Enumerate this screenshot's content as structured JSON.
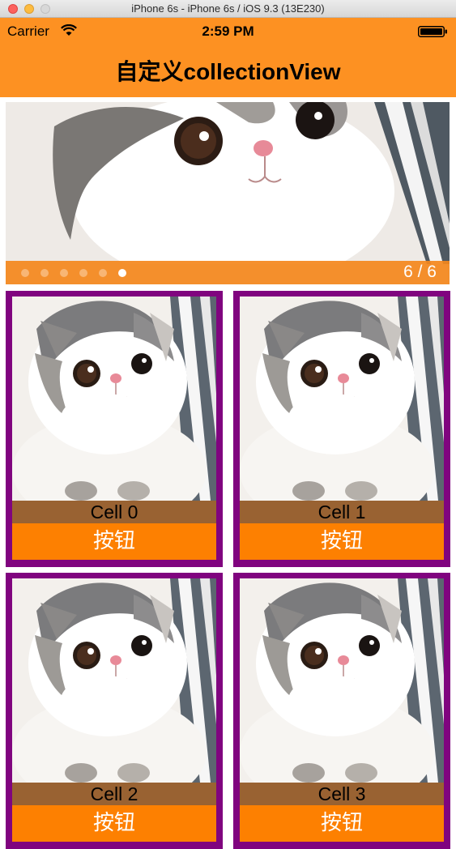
{
  "window": {
    "title": "iPhone 6s - iPhone 6s / iOS 9.3 (13E230)"
  },
  "status_bar": {
    "carrier": "Carrier",
    "time": "2:59 PM",
    "icons": [
      "wifi-icon",
      "battery-icon"
    ]
  },
  "nav": {
    "title": "自定义collectionView"
  },
  "banner": {
    "page_counter": "6 / 6",
    "page_count": 6,
    "current_page": 6
  },
  "cells": [
    {
      "label": "Cell 0",
      "button": "按钮"
    },
    {
      "label": "Cell 1",
      "button": "按钮"
    },
    {
      "label": "Cell 2",
      "button": "按钮"
    },
    {
      "label": "Cell 3",
      "button": "按钮"
    }
  ],
  "colors": {
    "nav_bar": "#fd9122",
    "cell_border": "#80047f",
    "cell_label_bg": "#996232",
    "cell_button_bg": "#fd8001",
    "banner_bar": "#f4871c"
  }
}
